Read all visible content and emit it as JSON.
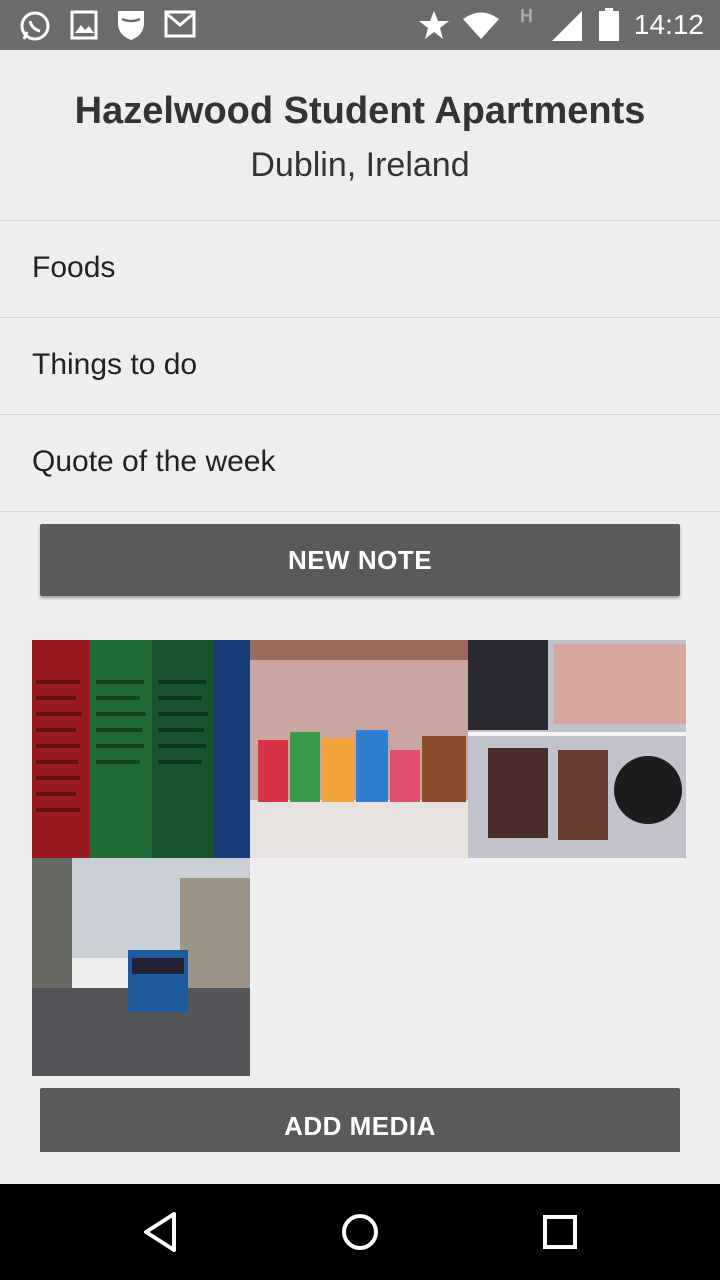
{
  "status_bar": {
    "time": "14:12",
    "icons": [
      "whatsapp-icon",
      "gallery-icon",
      "shield-icon",
      "gmail-icon",
      "star-icon",
      "wifi-icon",
      "hspa-icon",
      "signal-icon",
      "battery-icon"
    ],
    "network_label": "H"
  },
  "header": {
    "title": "Hazelwood Student Apartments",
    "subtitle": "Dublin, Ireland"
  },
  "list": {
    "items": [
      {
        "label": "Foods"
      },
      {
        "label": "Things to do"
      },
      {
        "label": "Quote of the week"
      }
    ]
  },
  "buttons": {
    "new_note": "NEW NOTE",
    "add_media": "ADD MEDIA"
  },
  "media": {
    "thumbnails": [
      "apartment-list-photo",
      "tea-boxes-photo",
      "fridge-photo",
      "street-bus-photo"
    ]
  },
  "nav_bar": {
    "icons": [
      "back-icon",
      "home-icon",
      "recents-icon"
    ]
  },
  "colors": {
    "status_bar": "#6b6b6b",
    "background": "#eeeeee",
    "button": "#5a5a5a",
    "nav_bar": "#000000"
  }
}
